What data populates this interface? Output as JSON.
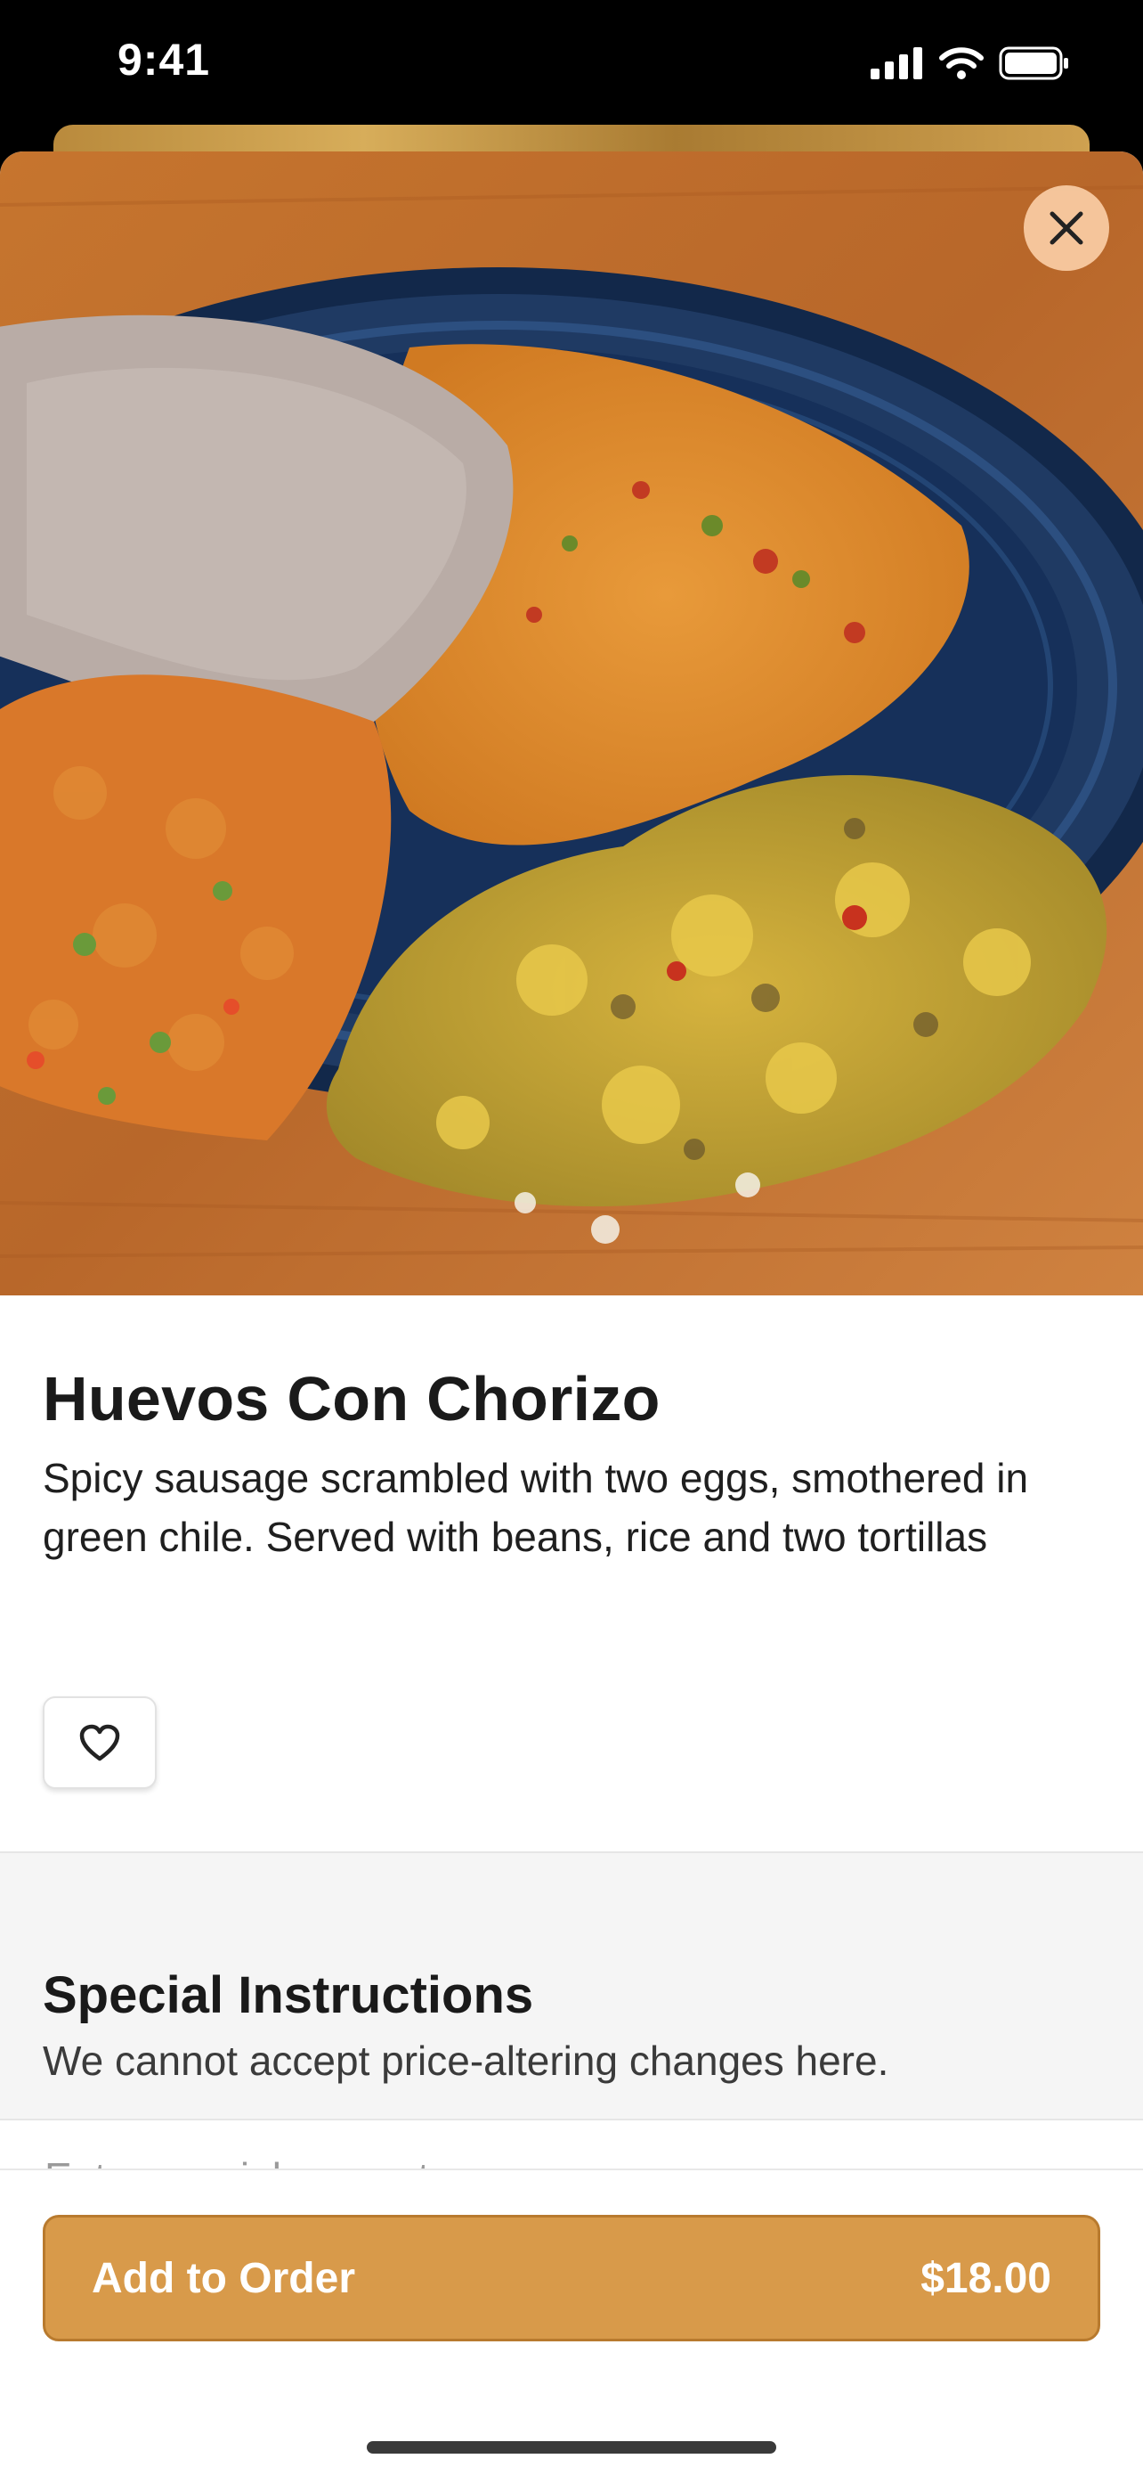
{
  "status_bar": {
    "time": "9:41"
  },
  "item": {
    "name": "Huevos Con Chorizo",
    "description": "Spicy sausage scrambled with two eggs, smothered in green chile. Served with beans, rice and two tortillas"
  },
  "special_instructions": {
    "title": "Special Instructions",
    "subtitle": "We cannot accept price-altering changes here.",
    "placeholder": "Enter special requests"
  },
  "footer": {
    "add_label": "Add to Order",
    "price": "$18.00"
  },
  "colors": {
    "accent": "#d89a4a",
    "close_button_bg": "#facda5",
    "plate": "#1f3a63"
  },
  "icons": {
    "close": "close-icon",
    "favorite": "heart-outline-icon",
    "signal": "cellular-signal-icon",
    "wifi": "wifi-icon",
    "battery": "battery-icon"
  }
}
